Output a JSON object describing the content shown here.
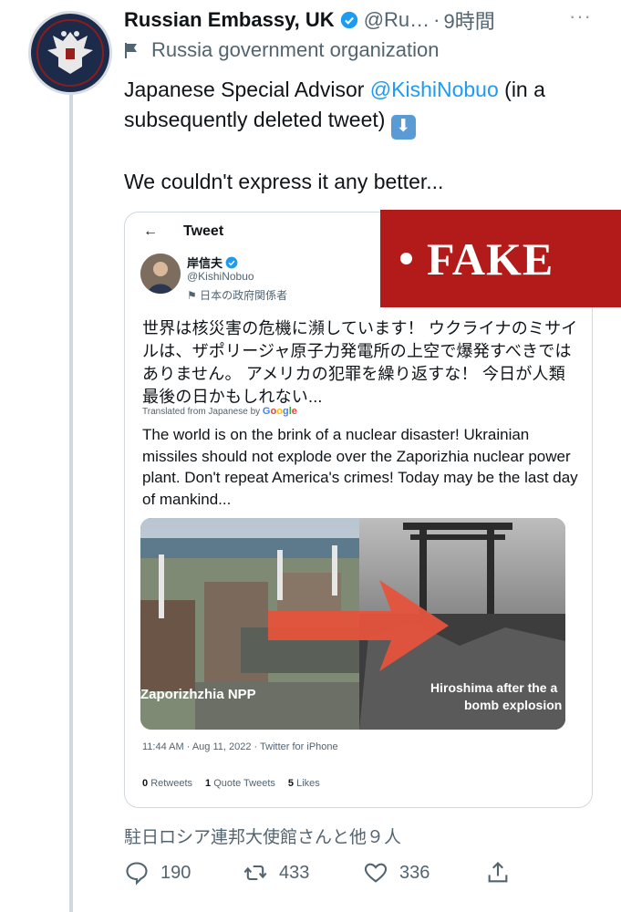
{
  "tweet": {
    "author_name": "Russian Embassy, UK",
    "handle": "@Ru…",
    "separator": "·",
    "time": "9時間",
    "more": "···",
    "org_label": "Russia government organization",
    "text_prefix": "Japanese Special Advisor ",
    "mention": "@KishiNobuo",
    "text_suffix": " (in a subsequently deleted tweet) ",
    "down_arrow": "⬇",
    "line2": "We couldn't express it any better...",
    "liked_by": "駐日ロシア連邦大使館さんと他９人",
    "stats": {
      "replies": "190",
      "retweets": "433",
      "likes": "336"
    }
  },
  "embedded": {
    "back_arrow": "←",
    "title": "Tweet",
    "name": "岸信夫",
    "handle": "@KishiNobuo",
    "org": "日本の政府関係者",
    "jp_text": "世界は核災害の危機に瀕しています！ ウクライナのミサイルは、ザポリージャ原子力発電所の上空で爆発すべきではありません。 アメリカの犯罪を繰り返すな！ 今日が人類最後の日かもしれない...",
    "translated_label": "Translated from Japanese by ",
    "translated_brand": "Google",
    "en_text": "The world is on the brink of a nuclear disaster! Ukrainian missiles should not explode over the Zaporizhia nuclear power plant. Don't repeat America's crimes! Today may be the last day of mankind...",
    "media_left_caption": "Zaporizhzhia NPP",
    "media_right_caption_1": "Hiroshima after the a",
    "media_right_caption_2": "bomb explosion",
    "meta": "11:44 AM · Aug 11, 2022 · Twitter for iPhone",
    "retweets_count": "0",
    "retweets_label": "Retweets",
    "quotes_count": "1",
    "quotes_label": "Quote Tweets",
    "likes_count": "5",
    "likes_label": "Likes"
  },
  "overlay": {
    "label": "FAKE",
    "color": "#b31b1b"
  },
  "icons": {
    "verified": "verified-badge-icon",
    "org": "flag-icon",
    "reply": "comment-icon",
    "retweet": "retweet-icon",
    "like": "heart-icon",
    "share": "share-icon"
  },
  "colors": {
    "link": "#1d9bf0",
    "secondary_text": "#536471",
    "primary_text": "#0f1419"
  }
}
